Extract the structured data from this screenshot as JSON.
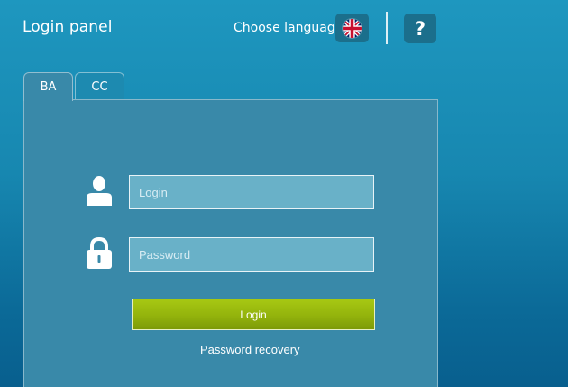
{
  "header": {
    "title": "Login panel",
    "language_label": "Choose language",
    "language_flag": "uk-flag-icon",
    "help_label": "?"
  },
  "tabs": [
    {
      "label": "BA",
      "active": true
    },
    {
      "label": "CC",
      "active": false
    }
  ],
  "form": {
    "login_placeholder": "Login",
    "login_value": "",
    "password_placeholder": "Password",
    "password_value": "",
    "submit_label": "Login",
    "recovery_link": "Password recovery"
  },
  "colors": {
    "background": "#1787b0",
    "panel": "#3989a9",
    "input": "#69b1c8",
    "button": "#93b30c"
  }
}
